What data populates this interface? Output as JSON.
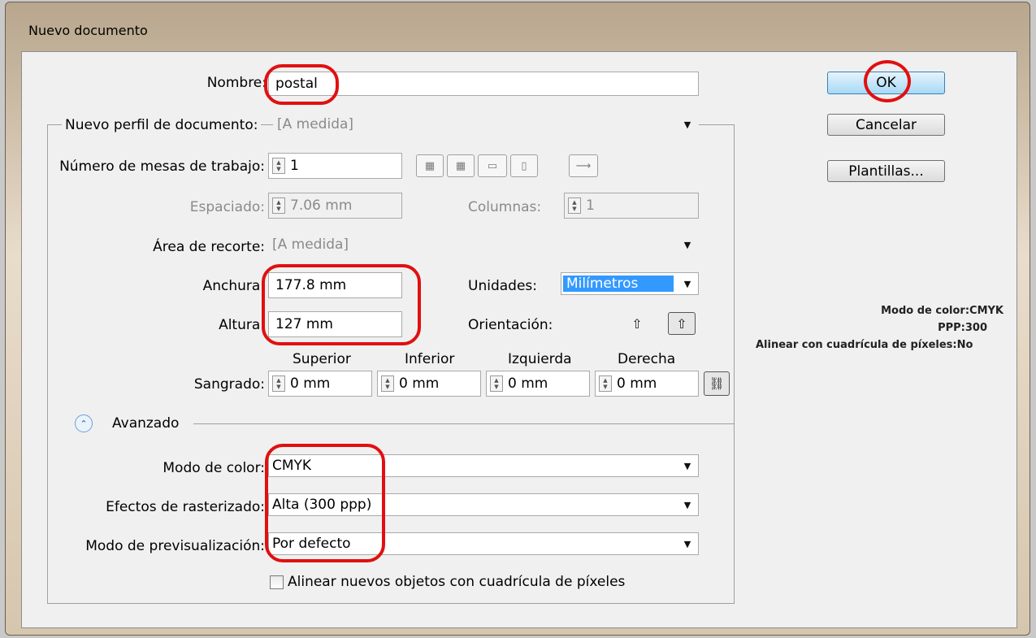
{
  "window": {
    "title": "Nuevo documento"
  },
  "form": {
    "nombre_label": "Nombre:",
    "nombre_value": "postal",
    "perfil_label": "Nuevo perfil de documento:",
    "perfil_value": "[A medida]",
    "mesas_label": "Número de mesas de trabajo:",
    "mesas_value": "1",
    "espaciado_label": "Espaciado:",
    "espaciado_value": "7.06 mm",
    "columnas_label": "Columnas:",
    "columnas_value": "1",
    "area_label": "Área de recorte:",
    "area_value": "[A medida]",
    "anchura_label": "Anchura:",
    "anchura_value": "177.8 mm",
    "altura_label": "Altura:",
    "altura_value": "127 mm",
    "unidades_label": "Unidades:",
    "unidades_value": "Milímetros",
    "orientacion_label": "Orientación:",
    "sangrado_label": "Sangrado:",
    "sangrado_headers": [
      "Superior",
      "Inferior",
      "Izquierda",
      "Derecha"
    ],
    "sangrado_values": [
      "0 mm",
      "0 mm",
      "0 mm",
      "0 mm"
    ],
    "avanzado_label": "Avanzado",
    "modo_color_label": "Modo de color:",
    "modo_color_value": "CMYK",
    "raster_label": "Efectos de rasterizado:",
    "raster_value": "Alta (300 ppp)",
    "previs_label": "Modo de previsualización:",
    "previs_value": "Por defecto",
    "alinear_label": "Alinear nuevos objetos con cuadrícula de píxeles",
    "alinear_checked": false
  },
  "buttons": {
    "ok": "OK",
    "cancel": "Cancelar",
    "templates": "Plantillas..."
  },
  "info": {
    "color_mode": "Modo de color:CMYK",
    "ppp": "PPP:300",
    "grid": "Alinear con cuadrícula de píxeles:No"
  },
  "colors": {
    "annotation": "#e01010",
    "selection": "#3399ff"
  }
}
